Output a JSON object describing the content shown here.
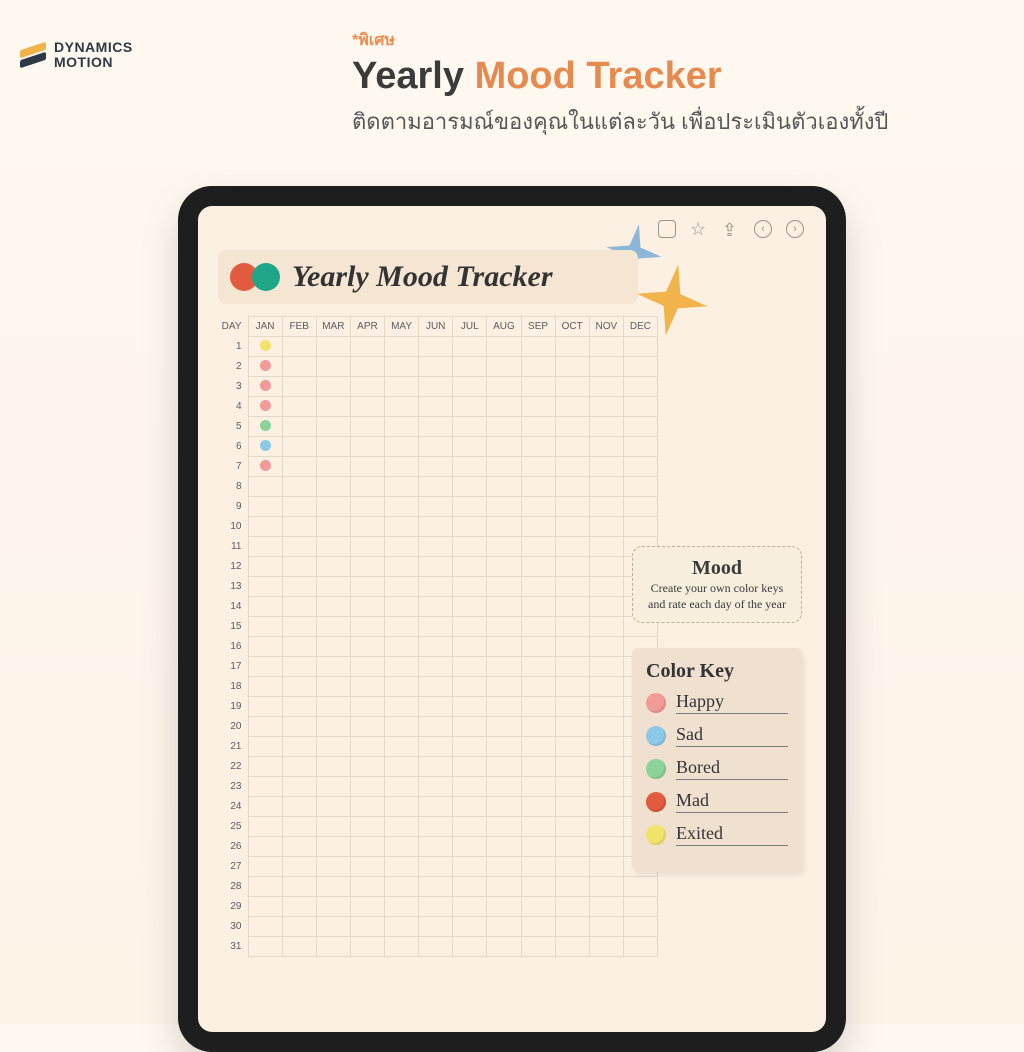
{
  "brand": {
    "line1": "DYNAMICS",
    "line2": "MOTION"
  },
  "headline": {
    "tag": "*พิเศษ",
    "title_plain": "Yearly ",
    "title_accent": "Mood Tracker",
    "subtitle": "ติดตามอารมณ์ของคุณในแต่ละวัน เพื่อประเมินตัวเองทั้งปี"
  },
  "toolbar": {
    "calendar": "calendar",
    "star": "star",
    "share": "share",
    "prev": "‹",
    "next": "›"
  },
  "planner": {
    "title": "Yearly Mood Tracker",
    "day_label": "DAY",
    "months": [
      "JAN",
      "FEB",
      "MAR",
      "APR",
      "MAY",
      "JUN",
      "JUL",
      "AUG",
      "SEP",
      "OCT",
      "NOV",
      "DEC"
    ],
    "days": 31,
    "filled": {
      "1": {
        "JAN": "#f2e36b"
      },
      "2": {
        "JAN": "#f19a9a"
      },
      "3": {
        "JAN": "#f19a9a"
      },
      "4": {
        "JAN": "#f19a9a"
      },
      "5": {
        "JAN": "#8bd39b"
      },
      "6": {
        "JAN": "#8cc9e8"
      },
      "7": {
        "JAN": "#f19a9a"
      }
    }
  },
  "moodnote": {
    "heading": "Mood",
    "body": "Create your own color keys and rate each day of the year"
  },
  "colorkey": {
    "heading": "Color Key",
    "items": [
      {
        "color": "#f19a9a",
        "label": "Happy"
      },
      {
        "color": "#8cc9e8",
        "label": "Sad"
      },
      {
        "color": "#8bd39b",
        "label": "Bored"
      },
      {
        "color": "#e25b3e",
        "label": "Mad"
      },
      {
        "color": "#f2e36b",
        "label": "Exited"
      }
    ]
  },
  "sparkles": {
    "blue": "#8db7d9",
    "yellow": "#f0b44a"
  }
}
